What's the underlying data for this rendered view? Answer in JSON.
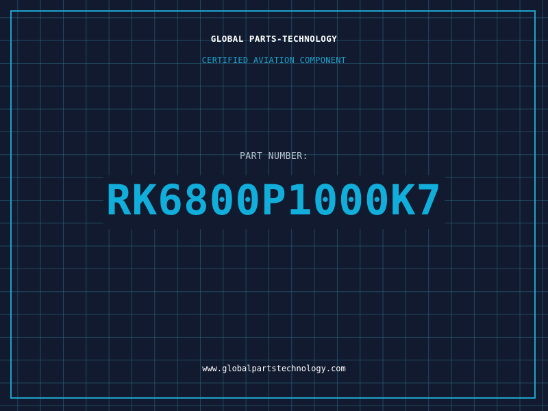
{
  "header": {
    "company": "GLOBAL PARTS-TECHNOLOGY",
    "subtitle": "CERTIFIED AVIATION COMPONENT"
  },
  "part": {
    "label": "PART NUMBER:",
    "number": "RK6800P1000K7"
  },
  "footer": {
    "website": "www.globalpartstechnology.com"
  },
  "colors": {
    "background": "#111a2e",
    "accent": "#12aedb",
    "grid": "#2e6e8c",
    "text": "#ffffff"
  }
}
